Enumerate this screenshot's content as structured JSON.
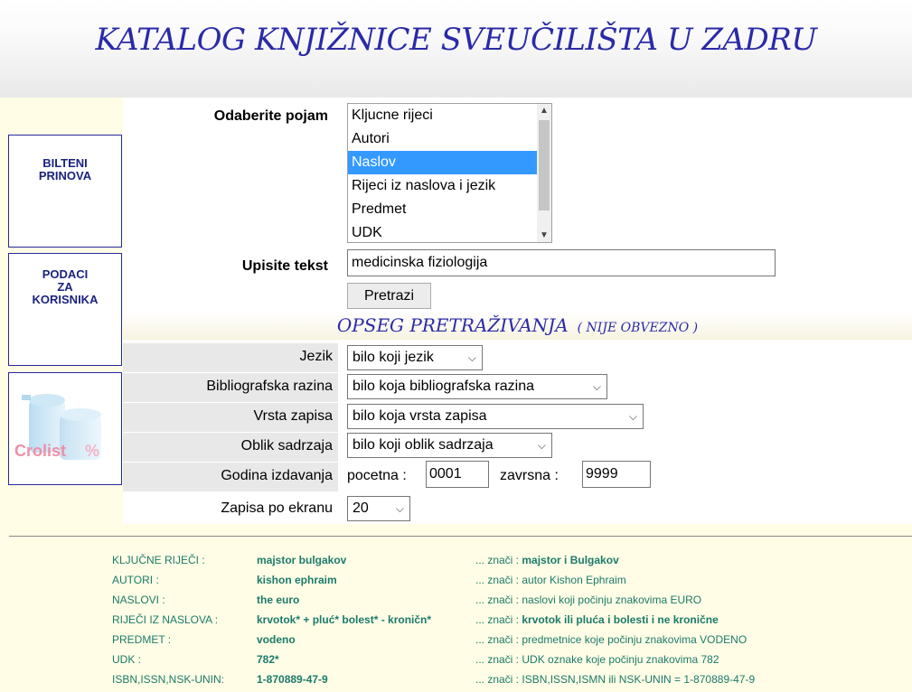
{
  "header": {
    "title": "KATALOG KNJIŽNICE SVEUČILIŠTA U ZADRU"
  },
  "sidebar": {
    "bilteni": [
      "BILTENI",
      "PRINOVA"
    ],
    "podaci": [
      "PODACI",
      "ZA",
      "KORISNIKA"
    ],
    "crolist": "Crolist"
  },
  "search": {
    "pojam_label": "Odaberite pojam",
    "options": [
      "Kljucne rijeci",
      "Autori",
      "Naslov",
      "Rijeci iz naslova i jezik",
      "Predmet",
      "UDK"
    ],
    "selected": "Naslov",
    "tekst_label": "Upisite tekst",
    "tekst_value": "medicinska fiziologija",
    "button_label": "Pretrazi"
  },
  "opseg": {
    "title": "OPSEG PRETRAŽIVANJA",
    "note": "( NIJE OBVEZNO )",
    "jezik_label": "Jezik",
    "jezik_value": "bilo koji jezik",
    "razina_label": "Bibliografska razina",
    "razina_value": "bilo koja bibliografska razina",
    "vrsta_label": "Vrsta zapisa",
    "vrsta_value": "bilo koja vrsta zapisa",
    "oblik_label": "Oblik sadrzaja",
    "oblik_value": "bilo koji oblik sadrzaja",
    "godina_label": "Godina izdavanja",
    "pocetna_label": "pocetna :",
    "pocetna_value": "0001",
    "zavrsna_label": "zavrsna :",
    "zavrsna_value": "9999",
    "zapisa_label": "Zapisa po ekranu",
    "zapisa_value": "20"
  },
  "help": [
    {
      "key": "KLJUČNE RIJEČI :",
      "example": "majstor bulgakov",
      "meaning_prefix": "... znači :",
      "meaning": "majstor i Bulgakov"
    },
    {
      "key": "AUTORI :",
      "example": "kishon ephraim",
      "meaning_prefix": "... znači :",
      "meaning": "autor Kishon Ephraim"
    },
    {
      "key": "NASLOVI :",
      "example": "the euro",
      "meaning_prefix": "... znači :",
      "meaning": "naslovi koji počinju znakovima EURO"
    },
    {
      "key": "RIJEČI IZ NASLOVA :",
      "example": "krvotok* + pluć* bolest* - kroničn*",
      "meaning_prefix": "... znači :",
      "meaning": "krvotok ili pluća i bolesti i ne kronične"
    },
    {
      "key": "PREDMET :",
      "example": "vodeno",
      "meaning_prefix": "... znači :",
      "meaning": "predmetnice koje počinju znakovima VODENO"
    },
    {
      "key": "UDK :",
      "example": "782*",
      "meaning_prefix": "... znači :",
      "meaning": "UDK oznake koje počinju znakovima 782"
    },
    {
      "key": "ISBN,ISSN,NSK-UNIN:",
      "example": "1-870889-47-9",
      "meaning_prefix": "... znači :",
      "meaning": "ISBN,ISSN,ISMN ili NSK-UNIN = 1-870889-47-9"
    }
  ]
}
